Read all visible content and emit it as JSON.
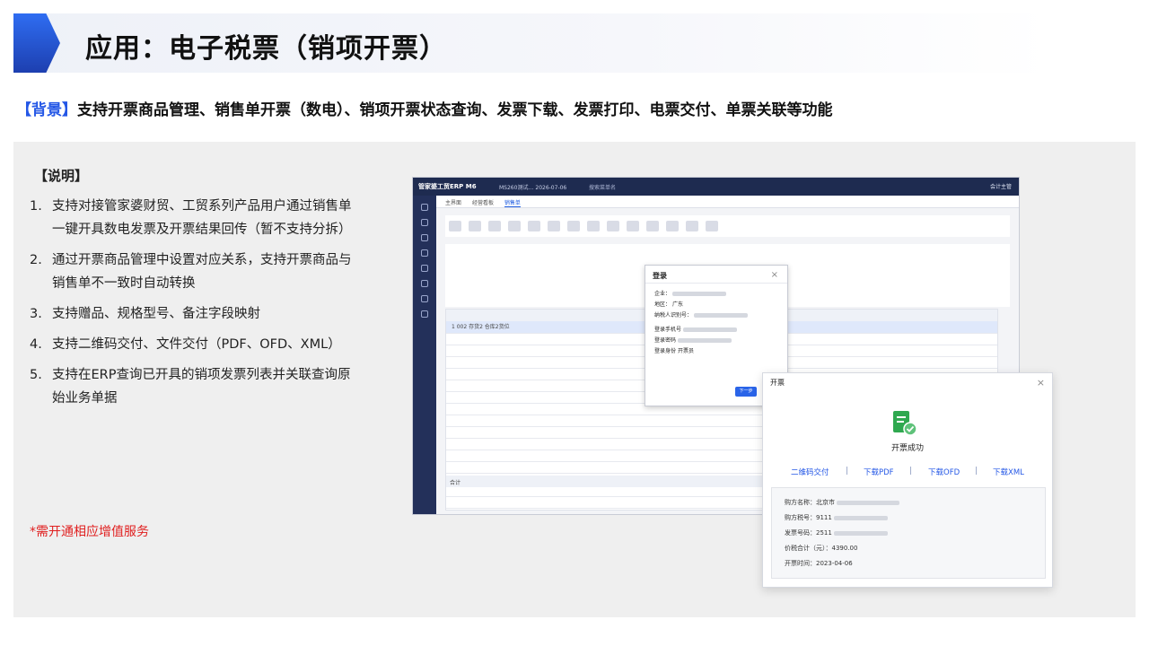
{
  "title": "应用：电子税票（销项开票）",
  "background": {
    "tag": "【背景】",
    "text": "支持开票商品管理、销售单开票（数电）、销项开票状态查询、发票下载、发票打印、电票交付、单票关联等功能"
  },
  "notes": {
    "heading": "【说明】",
    "items": [
      {
        "num": "1.",
        "text": "支持对接管家婆财贸、工贸系列产品用户通过销售单一键开具数电发票及开票结果回传（暂不支持分拆）"
      },
      {
        "num": "2.",
        "text": "通过开票商品管理中设置对应关系，支持开票商品与销售单不一致时自动转换"
      },
      {
        "num": "3.",
        "text": "支持赠品、规格型号、备注字段映射"
      },
      {
        "num": "4.",
        "text": "支持二维码交付、文件交付（PDF、OFD、XML）"
      },
      {
        "num": "5.",
        "text": "支持在ERP查询已开具的销项发票列表并关联查询原始业务单据"
      }
    ],
    "footnote": "*需开通相应增值服务"
  },
  "erp": {
    "logo": "管家婆工贸ERP M6",
    "company": "MS260测试…",
    "date": "2026-07-06",
    "search_placeholder": "搜索菜单名",
    "user": "会计主管",
    "tabs": [
      "主界面",
      "经营看板",
      "销售单"
    ],
    "grid_row": "1  002  存货2  仓库2货位",
    "sum_label": "合计"
  },
  "login": {
    "title": "登录",
    "company_label": "企业：",
    "region_label": "地区：",
    "region_value": "广东",
    "taxid_label": "纳税人识别号：",
    "phone_label": "登录手机号",
    "password_label": "登录密码",
    "role_label": "登录身份",
    "role_value": "开票员",
    "next_button": "下一步"
  },
  "success": {
    "title": "开票",
    "message": "开票成功",
    "links": [
      "二维码交付",
      "下载PDF",
      "下载OFD",
      "下载XML"
    ],
    "buyer_name_label": "购方名称：",
    "buyer_name_value": "北京市",
    "buyer_tax_label": "购方税号：",
    "buyer_tax_value": "9111",
    "invoice_no_label": "发票号码：",
    "invoice_no_value": "2511",
    "total_label": "价税合计（元）：",
    "total_value": "4390.00",
    "time_label": "开票时间：",
    "time_value": "2023-04-06"
  }
}
